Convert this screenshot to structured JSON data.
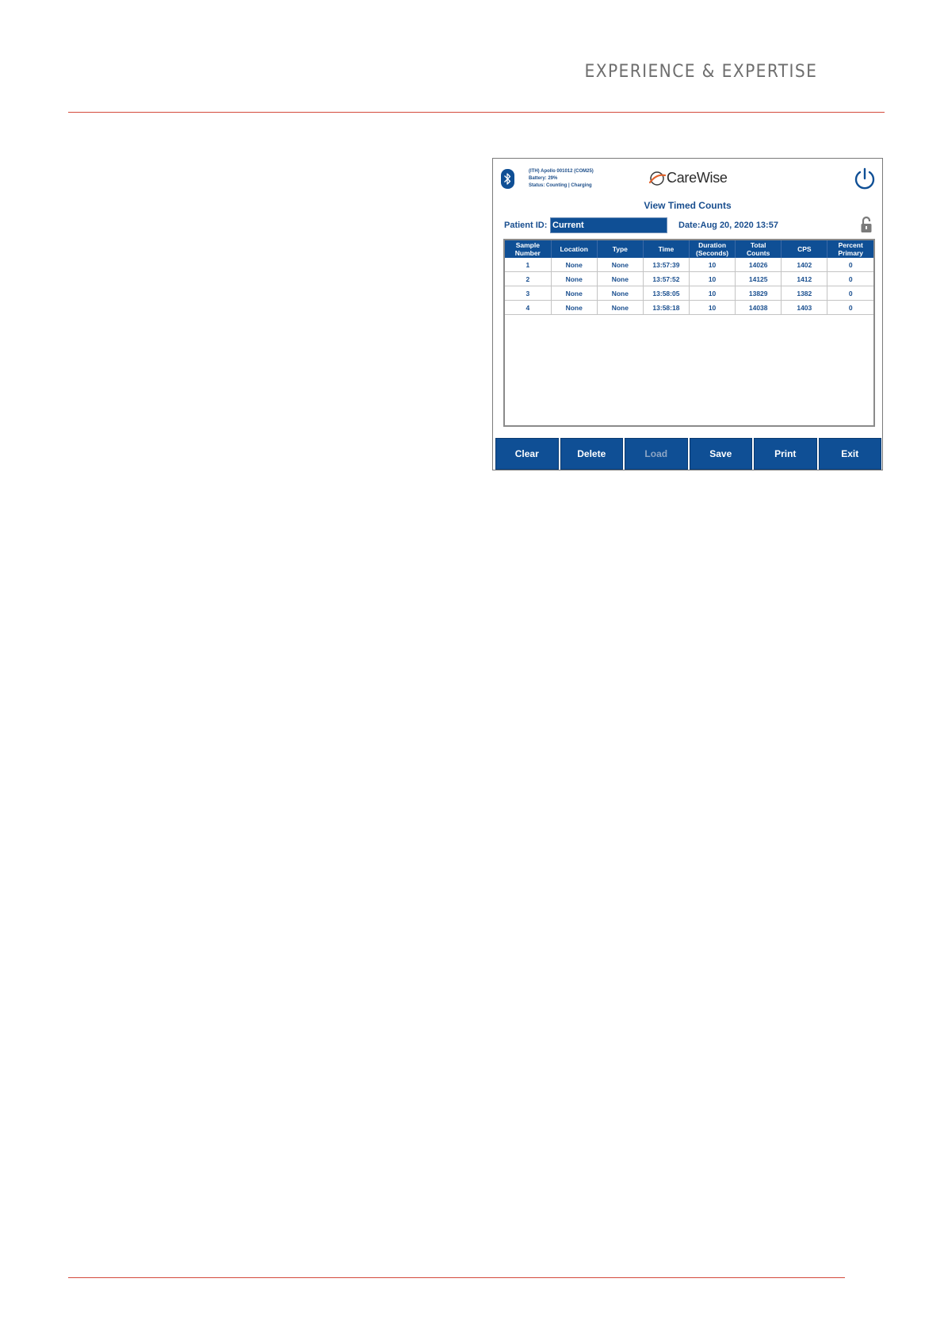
{
  "page": {
    "header_text": "EXPERIENCE & EXPERTISE",
    "colors": {
      "rule": "#d44a3c",
      "header_text": "#6e6e6e"
    }
  },
  "app": {
    "status": {
      "line1": "(ITH) Apollo 001012 (COM25)",
      "line2": "Battery: 29%",
      "line3": "Status: Counting | Charging"
    },
    "brand": "CareWise",
    "title": "View Timed Counts",
    "patient_id_label": "Patient ID:",
    "patient_id_value": "Current",
    "date_label": "Date:Aug 20, 2020 13:57",
    "icons": {
      "bluetooth": "bluetooth-icon",
      "power": "power-icon",
      "lock": "unlock-icon",
      "logo": "carewise-logo-icon"
    },
    "colors": {
      "primary": "#0f4f95",
      "text": "#1a4f8f",
      "disabled_text": "#8da5c4"
    },
    "table": {
      "columns": [
        [
          "Sample",
          "Number"
        ],
        [
          "Location"
        ],
        [
          "Type"
        ],
        [
          "Time"
        ],
        [
          "Duration",
          "(Seconds)"
        ],
        [
          "Total",
          "Counts"
        ],
        [
          "CPS"
        ],
        [
          "Percent",
          "Primary"
        ]
      ],
      "rows": [
        [
          "1",
          "None",
          "None",
          "13:57:39",
          "10",
          "14026",
          "1402",
          "0"
        ],
        [
          "2",
          "None",
          "None",
          "13:57:52",
          "10",
          "14125",
          "1412",
          "0"
        ],
        [
          "3",
          "None",
          "None",
          "13:58:05",
          "10",
          "13829",
          "1382",
          "0"
        ],
        [
          "4",
          "None",
          "None",
          "13:58:18",
          "10",
          "14038",
          "1403",
          "0"
        ]
      ]
    },
    "buttons": [
      {
        "label": "Clear",
        "enabled": true
      },
      {
        "label": "Delete",
        "enabled": true
      },
      {
        "label": "Load",
        "enabled": false
      },
      {
        "label": "Save",
        "enabled": true
      },
      {
        "label": "Print",
        "enabled": true
      },
      {
        "label": "Exit",
        "enabled": true
      }
    ]
  }
}
